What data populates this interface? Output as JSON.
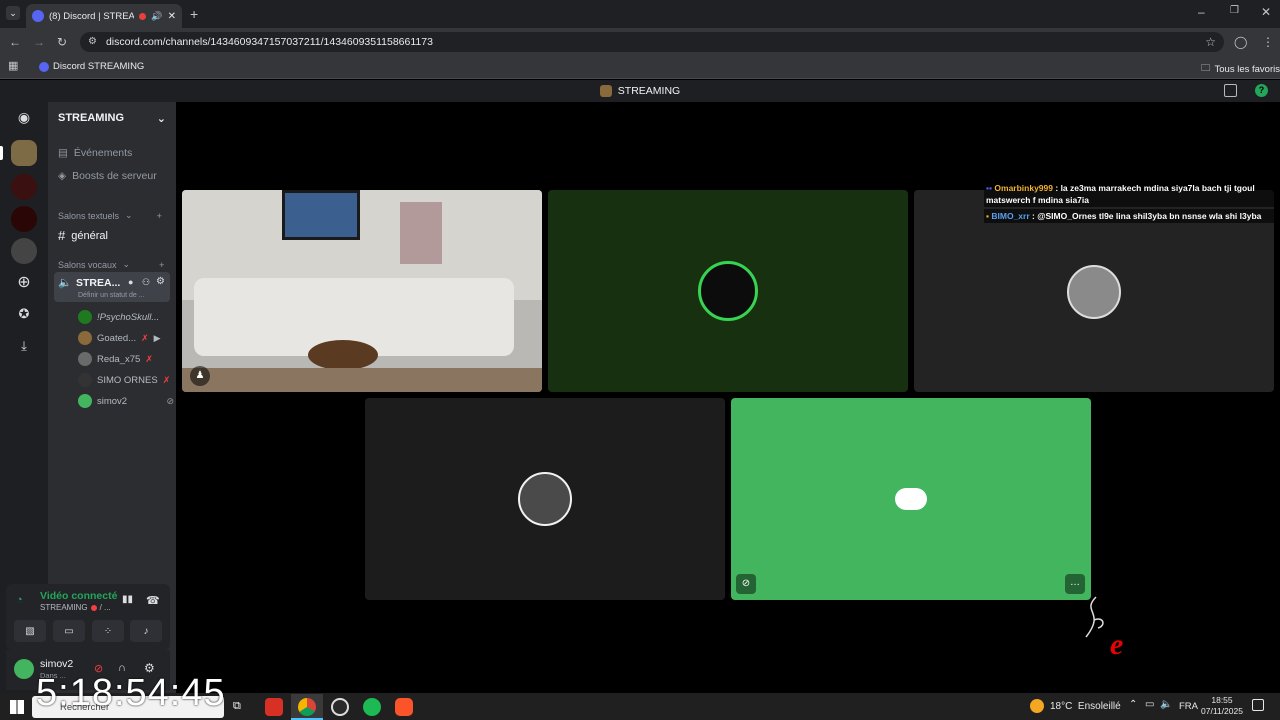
{
  "browser": {
    "tab_title": "(8) Discord | STREAMING",
    "url": "discord.com/channels/1434609347157037211/1434609351158661173",
    "bookmark": "Discord STREAMING",
    "all_bookmarks": "Tous les favoris"
  },
  "topbar": {
    "title": "STREAMING"
  },
  "server": {
    "name": "STREAMING",
    "events": "Événements",
    "boosts": "Boosts de serveur",
    "text_category": "Salons textuels",
    "text_channel": "général",
    "voice_category": "Salons vocaux",
    "voice_channel": "STREA...",
    "voice_status": "Définir un statut de ..."
  },
  "voice_users": [
    {
      "name": "!PsychoSkull..."
    },
    {
      "name": "Goated..."
    },
    {
      "name": "Reda_x75"
    },
    {
      "name": "SIMO ORNES"
    },
    {
      "name": "simov2"
    }
  ],
  "voice_panel": {
    "status": "Vidéo connecté",
    "channel": "STREAMING",
    "sub": "/ ..."
  },
  "user_panel": {
    "name": "simov2",
    "status": "Dans ..."
  },
  "chat_overlay": [
    {
      "author": "Omarbinky999",
      "text": ": la ze3ma marrakech mdina siya7la bach tji tgoul matswerch f mdina sia7ia"
    },
    {
      "author": "BIMO_xrr",
      "text": ": @SIMO_Ornes tl9e lina shil3yba bn nsnse wla shi l3yba"
    }
  ],
  "clock_overlay": "5:18:54:45",
  "taskbar": {
    "search": "Rechercher",
    "weather": "18°C  Ensoleillé",
    "lang": "FRA",
    "time": "18:55",
    "date": "07/11/2025"
  },
  "colors": {
    "accent": "#5865f2",
    "green_tile": "#43b55f",
    "dark_green_tile": "#17300f",
    "online": "#23a55a"
  }
}
